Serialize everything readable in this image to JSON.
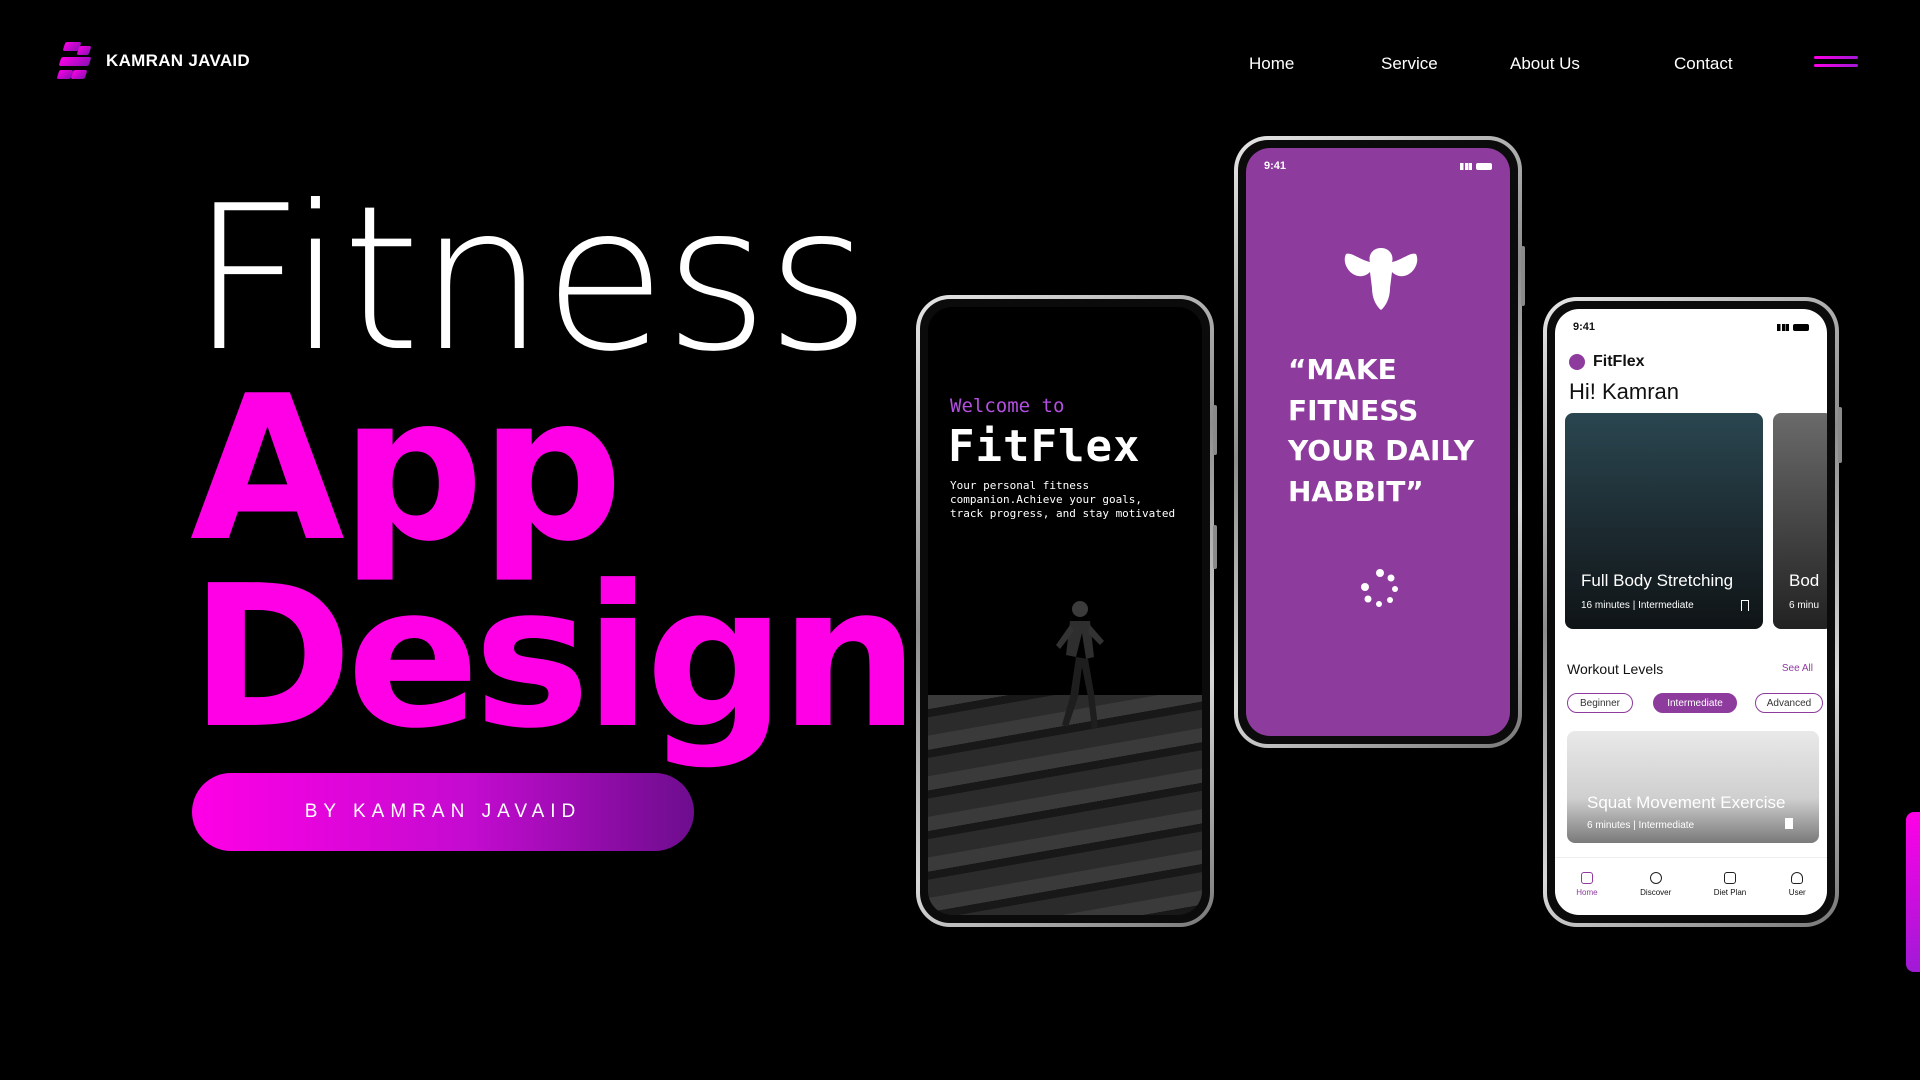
{
  "brand": {
    "name": "KAMRAN JAVAID"
  },
  "nav": {
    "items": [
      {
        "label": "Home"
      },
      {
        "label": "Service"
      },
      {
        "label": "About Us"
      },
      {
        "label": "Contact"
      }
    ],
    "menu_icon": "hamburger-icon"
  },
  "hero": {
    "line1": "Fitness",
    "line2": "App",
    "line3": "Design",
    "cta": "BY KAMRAN JAVAID"
  },
  "colors": {
    "accent": "#ff00e6",
    "purple": "#8e3b9e"
  },
  "phone1": {
    "welcome": "Welcome to",
    "title": "FitFlex",
    "description": "Your personal fitness companion.Achieve your goals, track progress, and stay motivated"
  },
  "phone2": {
    "time": "9:41",
    "quote": "“MAKE FITNESS YOUR DAILY HABBIT”"
  },
  "phone3": {
    "time": "9:41",
    "app_name": "FitFlex",
    "greeting": "Hi! Kamran",
    "cards": [
      {
        "title": "Full Body Stretching",
        "meta": "16 minutes  |  Intermediate"
      },
      {
        "title": "Bod",
        "meta": "6 minu"
      }
    ],
    "levels_title": "Workout Levels",
    "see_all": "See All",
    "levels": [
      "Beginner",
      "Intermediate",
      "Advanced"
    ],
    "active_level": "Intermediate",
    "exercise": {
      "title": "Squat Movement Exercise",
      "meta": "6 minutes  |  Intermediate"
    },
    "tabs": [
      "Home",
      "Discover",
      "Diet Plan",
      "User"
    ]
  }
}
